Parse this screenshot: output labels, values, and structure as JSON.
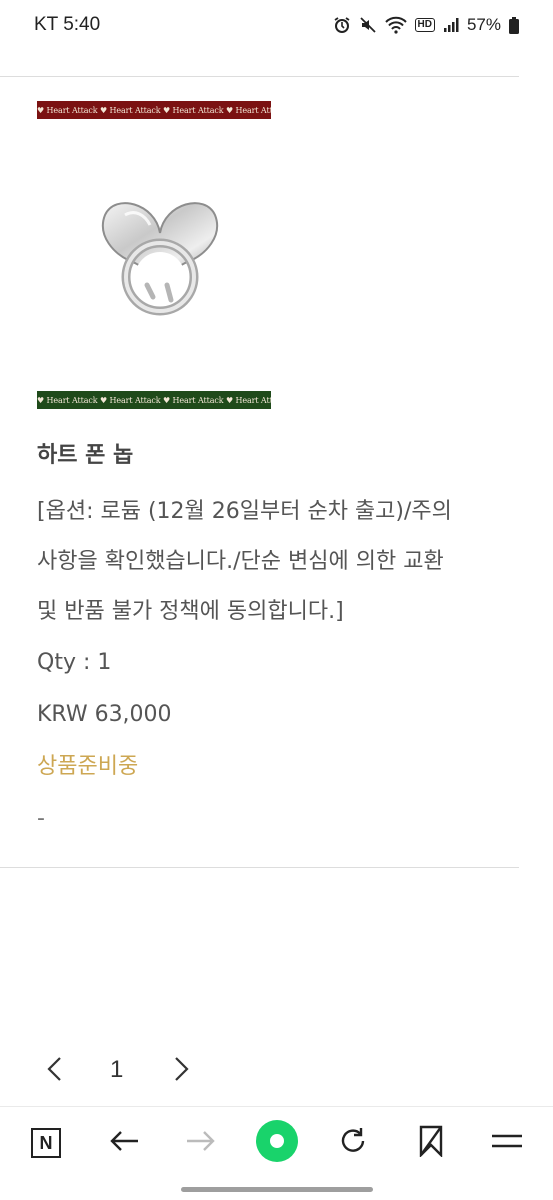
{
  "status_bar": {
    "carrier_time": "KT 5:40",
    "battery": "57%",
    "network_badge": "HD"
  },
  "banner": {
    "text": "♥ Heart Attack ♥ Heart Attack ♥ Heart Attack ♥ Heart Attack"
  },
  "product": {
    "name": "하트 폰 놉",
    "options_line1": "[옵션: 로듐 (12월 26일부터 순차 출고)/주의",
    "options_line2": "사항을 확인했습니다./단순 변심에 의한 교환",
    "options_line3": "및 반품 불가 정책에 동의합니다.]",
    "qty": "Qty : 1",
    "price": "KRW 63,000",
    "status": "상품준비중",
    "dash": "-"
  },
  "pagination": {
    "current_page": "1"
  },
  "toolbar": {
    "n_icon_letter": "N"
  },
  "colors": {
    "status": "#cda753",
    "banner_red": "#7b1212",
    "banner_green": "#1f4a1a",
    "toolbar_accent": "#19d36b"
  }
}
